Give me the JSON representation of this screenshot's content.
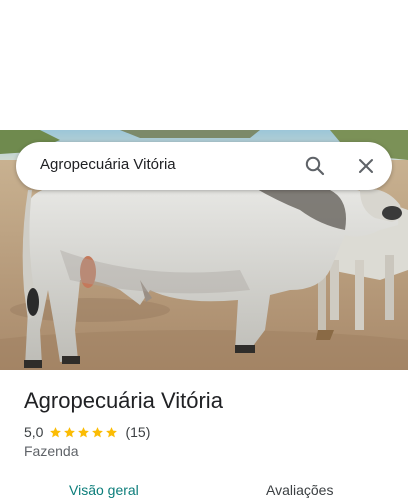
{
  "search": {
    "query": "Agropecuária Vitória"
  },
  "place": {
    "title": "Agropecuária Vitória",
    "rating": "5,0",
    "stars": 5,
    "review_count": "(15)",
    "category": "Fazenda"
  },
  "tabs": [
    {
      "label": "Visão geral",
      "active": true
    },
    {
      "label": "Avaliações",
      "active": false
    }
  ],
  "colors": {
    "star": "#fbbc04",
    "active_tab": "#0b7d7a"
  },
  "icons": {
    "search": "search-icon",
    "close": "close-icon",
    "star": "star-icon"
  }
}
